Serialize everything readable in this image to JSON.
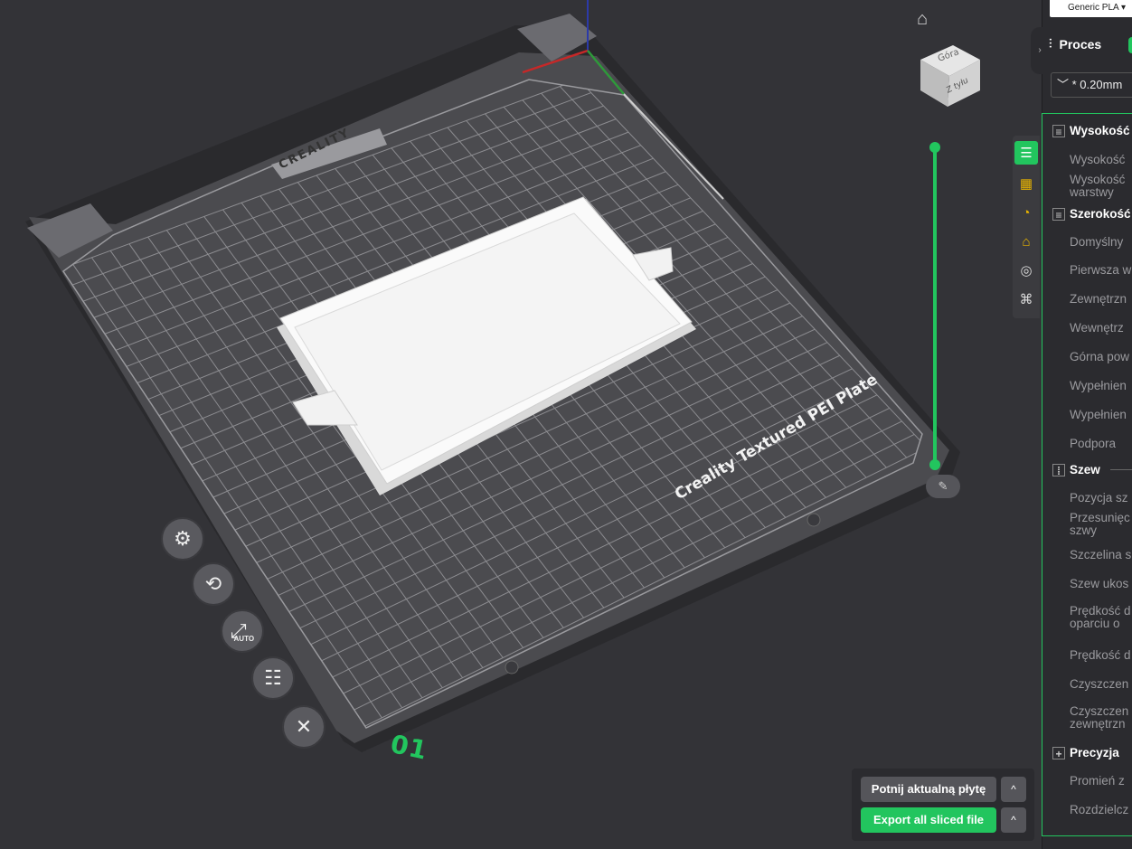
{
  "viewport": {
    "plate_name": "Creality Textured PEI Plate",
    "plate_number": "01",
    "brand": "CREALITY",
    "home_icon": "home-icon",
    "view_cube": {
      "top_label": "Góra",
      "side_label": "Z tyłu"
    },
    "left_tools": [
      {
        "name": "settings-icon",
        "glyph": "⚙"
      },
      {
        "name": "rotate-object-icon",
        "glyph": "⟲"
      },
      {
        "name": "auto-arrange-icon",
        "glyph": "⤢",
        "label": "AUTO"
      },
      {
        "name": "layout-icon",
        "glyph": "☷"
      },
      {
        "name": "close-icon",
        "glyph": "✕"
      }
    ],
    "layer_slider": {
      "icon": "edit-icon"
    }
  },
  "actions": {
    "slice_label": "Potnij aktualną płytę",
    "export_label": "Export all sliced file",
    "caret": "^"
  },
  "sidebar_tabs": [
    {
      "name": "quality-tab-icon",
      "glyph": "☰",
      "active": true
    },
    {
      "name": "strength-tab-icon",
      "glyph": "▦",
      "color": "#e8b400"
    },
    {
      "name": "speed-tab-icon",
      "glyph": "◔",
      "color": "#e8b400"
    },
    {
      "name": "support-tab-icon",
      "glyph": "⌂",
      "color": "#e8b400"
    },
    {
      "name": "multimaterial-tab-icon",
      "glyph": "◎",
      "color": "#ddd"
    },
    {
      "name": "others-tab-icon",
      "glyph": "⌘",
      "color": "#ddd"
    }
  ],
  "panel": {
    "filament": "Generic PLA",
    "process_title": "Proces",
    "profile": "* 0.20mm",
    "sections": [
      {
        "title": "Wysokość",
        "options": [
          "Wysokość",
          "Wysokość\nwarstwy"
        ]
      },
      {
        "title": "Szerokość",
        "options": [
          "Domyślny",
          "Pierwsza w",
          "Zewnętrzn",
          "Wewnętrz",
          "Górna pow",
          "Wypełnien",
          "Wypełnien",
          "Podpora"
        ]
      },
      {
        "title": "Szew",
        "options": [
          "Pozycja sz",
          "Przesunięc\nszwy",
          "Szczelina s",
          "Szew ukos",
          "Prędkość d\noparciu o",
          "Prędkość d",
          "Czyszczen",
          "Czyszczen\nzewnętrzn"
        ]
      },
      {
        "title": "Precyzja",
        "options": [
          "Promień z",
          "Rozdzielcz"
        ]
      }
    ]
  },
  "colors": {
    "accent": "#22c55e",
    "plate": "#4a4a4e",
    "model": "#f0f0f0"
  }
}
